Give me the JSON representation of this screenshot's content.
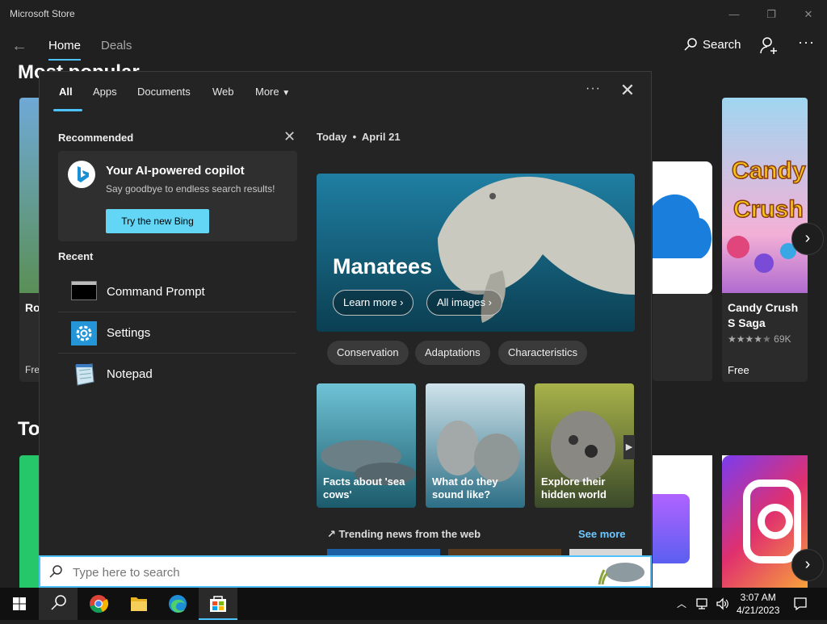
{
  "window": {
    "title": "Microsoft Store",
    "minimize": "—",
    "restore": "❐",
    "close": "✕"
  },
  "nav": {
    "back": "←",
    "tabs": [
      {
        "label": "Home"
      },
      {
        "label": "Deals"
      }
    ],
    "search_label": "Search",
    "more": "···"
  },
  "store": {
    "section1_title": "Most popular",
    "section2_title": "To",
    "left_card_name": "Ro",
    "left_card_price": "Fre",
    "candy": {
      "name": "Candy Crush S Saga",
      "rating_count": "69K",
      "price": "Free"
    },
    "arrow": "›"
  },
  "flyout": {
    "tabs": [
      {
        "label": "All"
      },
      {
        "label": "Apps"
      },
      {
        "label": "Documents"
      },
      {
        "label": "Web"
      },
      {
        "label": "More"
      }
    ],
    "more_dots": "···",
    "close": "✕",
    "recommended": {
      "title": "Recommended",
      "close": "✕",
      "card_title": "Your AI-powered copilot",
      "card_subtitle": "Say goodbye to endless search results!",
      "button": "Try the new Bing"
    },
    "recent": {
      "title": "Recent",
      "items": [
        {
          "label": "Command Prompt",
          "icon": "command-prompt-icon"
        },
        {
          "label": "Settings",
          "icon": "settings-gear-icon"
        },
        {
          "label": "Notepad",
          "icon": "notepad-icon"
        }
      ]
    },
    "today": {
      "label": "Today",
      "sep": "•",
      "date": "April 21",
      "hero_title": "Manatees",
      "learn_more": "Learn more",
      "all_images": "All images",
      "chips": [
        {
          "label": "Conservation"
        },
        {
          "label": "Adaptations"
        },
        {
          "label": "Characteristics"
        }
      ],
      "tiles": [
        {
          "label": "Facts about 'sea cows'"
        },
        {
          "label": "What do they sound like?"
        },
        {
          "label": "Explore their hidden world"
        }
      ],
      "trending": "Trending news from the web",
      "see_more": "See more"
    }
  },
  "searchbox": {
    "placeholder": "Type here to search"
  },
  "taskbar": {
    "time": "3:07 AM",
    "date": "4/21/2023"
  },
  "colors": {
    "accent": "#4cc2ff",
    "bing_button": "#63d6f5",
    "see_more": "#6ec8ff"
  }
}
